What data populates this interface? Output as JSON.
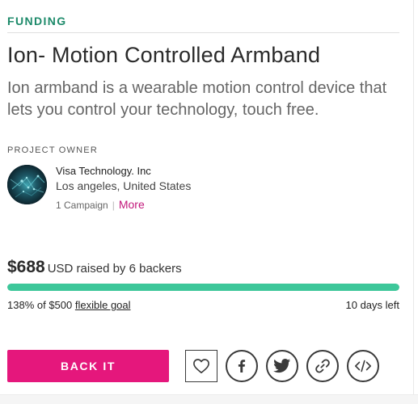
{
  "category": "FUNDING",
  "campaign": {
    "title": "Ion- Motion Controlled Armband",
    "tagline": "Ion armband is a wearable motion control device that lets you control your technology, touch free."
  },
  "owner": {
    "heading": "PROJECT OWNER",
    "name": "Visa Technology. Inc",
    "location": "Los angeles, United States",
    "campaigns": "1 Campaign",
    "separator": "|",
    "more_link": "More",
    "avatar_icon": "company-avatar"
  },
  "funding": {
    "amount": "$688",
    "raised_text": "USD raised by 6 backers",
    "percent_text": "138% of $500",
    "goal_type": "flexible goal",
    "days_left": "10 days left",
    "progress_percent": 100,
    "progress_color": "#3dc79a"
  },
  "actions": {
    "back_label": "BACK IT",
    "back_color": "#e5177c",
    "follow_icon": "heart-icon",
    "share_icons": [
      "facebook-icon",
      "twitter-icon",
      "link-icon",
      "embed-code-icon"
    ]
  },
  "colors": {
    "category": "#1d8a6a",
    "more_link": "#c2187b"
  }
}
